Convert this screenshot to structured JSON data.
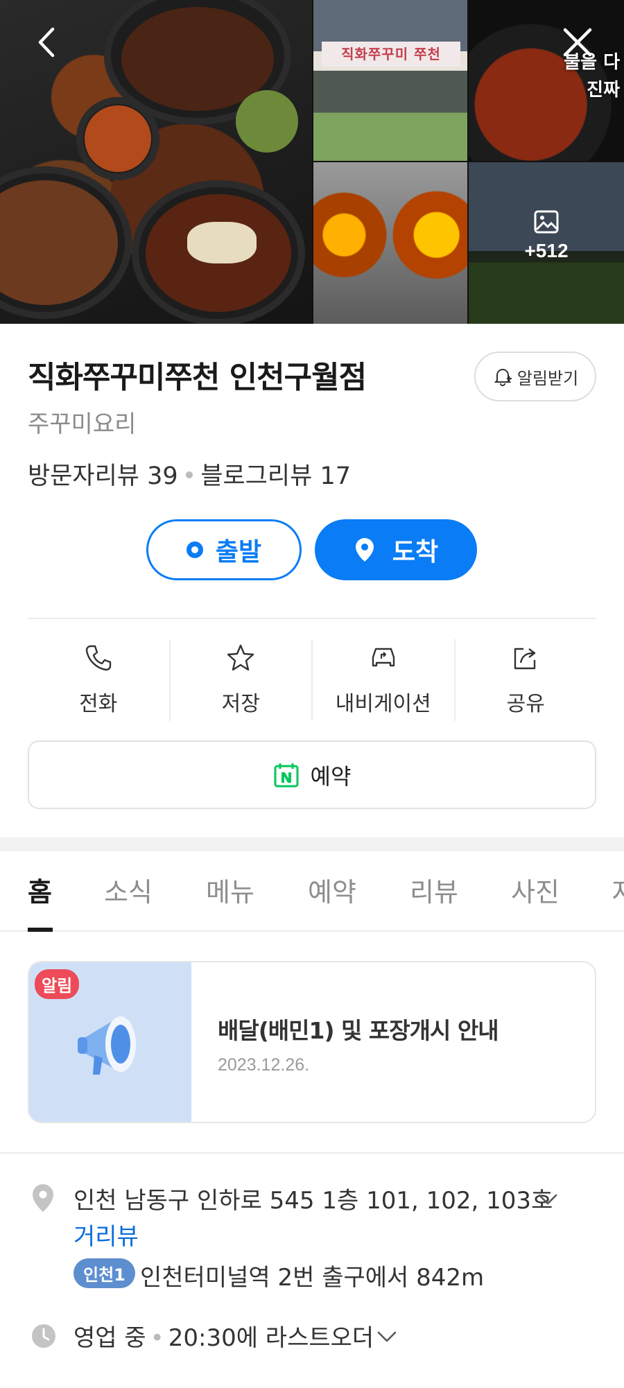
{
  "gallery": {
    "store_sign": "직화쭈꾸미 쭈천",
    "promo_text_line1": "불을 다",
    "promo_text_line2": "진짜",
    "more_count": "+512"
  },
  "place": {
    "name": "직화쭈꾸미쭈천 인천구월점",
    "category": "주꾸미요리",
    "visitor_reviews": "방문자리뷰 39",
    "blog_reviews": "블로그리뷰 17",
    "alarm_label": "알림받기"
  },
  "route": {
    "start_label": "출발",
    "arrive_label": "도착"
  },
  "actions": [
    {
      "label": "전화",
      "icon": "phone-icon"
    },
    {
      "label": "저장",
      "icon": "star-icon"
    },
    {
      "label": "내비게이션",
      "icon": "car-icon"
    },
    {
      "label": "공유",
      "icon": "share-icon"
    }
  ],
  "reserve_label": "예약",
  "tabs": [
    "홈",
    "소식",
    "메뉴",
    "예약",
    "리뷰",
    "사진",
    "지"
  ],
  "notice": {
    "badge": "알림",
    "title": "배달(배민1) 및 포장개시 안내",
    "date": "2023.12.26."
  },
  "info": {
    "address": "인천 남동구 인하로 545 1층 101, 102, 103호",
    "streetview": "거리뷰",
    "subway_line": "인천1",
    "subway_text": "인천터미널역 2번 출구에서 842m",
    "status": "영업 중",
    "last_order": "20:30에 라스트오더"
  },
  "colors": {
    "accent": "#0a7cf5",
    "badge_red": "#ec4b57",
    "subway": "#5d8ed0",
    "reserve_green": "#03c75a"
  }
}
